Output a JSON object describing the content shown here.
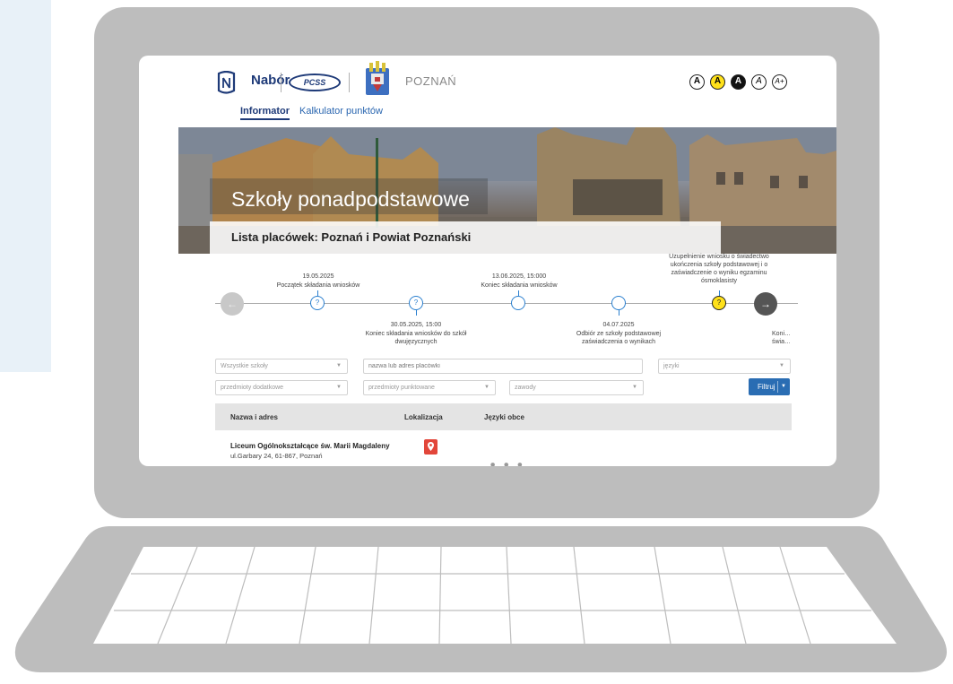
{
  "header": {
    "brand": "Nabór",
    "partner": "PCSS",
    "city": "POZNAŃ",
    "a11y_buttons": [
      {
        "label": "A",
        "bg": "#ffffff",
        "fg": "#222222"
      },
      {
        "label": "A",
        "bg": "#ffe11a",
        "fg": "#222222"
      },
      {
        "label": "A",
        "bg": "#111111",
        "fg": "#ffffff"
      },
      {
        "label": "A",
        "bg": "#ffffff",
        "fg": "#222222"
      },
      {
        "label": "A+",
        "bg": "#ffffff",
        "fg": "#222222"
      }
    ]
  },
  "nav": {
    "tabs": [
      {
        "label": "Informator",
        "active": true
      },
      {
        "label": "Kalkulator punktów",
        "active": false
      }
    ]
  },
  "hero": {
    "title": "Szkoły ponadpodstawowe",
    "subtitle": "Lista placówek: Poznań i Powiat Poznański"
  },
  "timeline": {
    "prev_arrow": "←",
    "next_arrow": "→",
    "events": [
      {
        "date": "19.05.2025",
        "text": "Początek składania wniosków",
        "icon": "?"
      },
      {
        "date": "30.05.2025, 15:00",
        "text": "Koniec składania wniosków do szkół dwujęzycznych",
        "icon": "?"
      },
      {
        "date": "13.06.2025, 15:000",
        "text": "Koniec składania wniosków",
        "icon": ""
      },
      {
        "date": "04.07.2025",
        "text": "Odbiór ze szkoły podstawowej zaświadczenia o wynikach",
        "icon": ""
      },
      {
        "date": "",
        "text": "Uzupełnienie wniosku o świadectwo ukończenia szkoły podstawowej i o zaświadczenie o wyniku egzaminu ósmoklasisty",
        "icon": "?"
      },
      {
        "date": "",
        "text": "Koni… świa…",
        "icon": ""
      }
    ]
  },
  "filters": {
    "schools": "Wszystkie szkoły",
    "search_placeholder": "nazwa lub adres placówki",
    "languages": "języki",
    "extra_subjects": "przedmioty dodatkowe",
    "scored_subjects": "przedmioty punktowane",
    "professions": "zawody",
    "filter_button": "Filtruj"
  },
  "table": {
    "columns": [
      "Nazwa i adres",
      "Lokalizacja",
      "Języki obce"
    ],
    "rows": [
      {
        "name": "Liceum Ogólnokształcące św. Marii Magdaleny",
        "address": "ul.Garbary 24, 61-867, Poznań"
      }
    ]
  },
  "colors": {
    "brand": "#1e3a78",
    "accent": "#2a6db3",
    "laptop": "#bdbdbd",
    "pin": "#e2463a"
  }
}
